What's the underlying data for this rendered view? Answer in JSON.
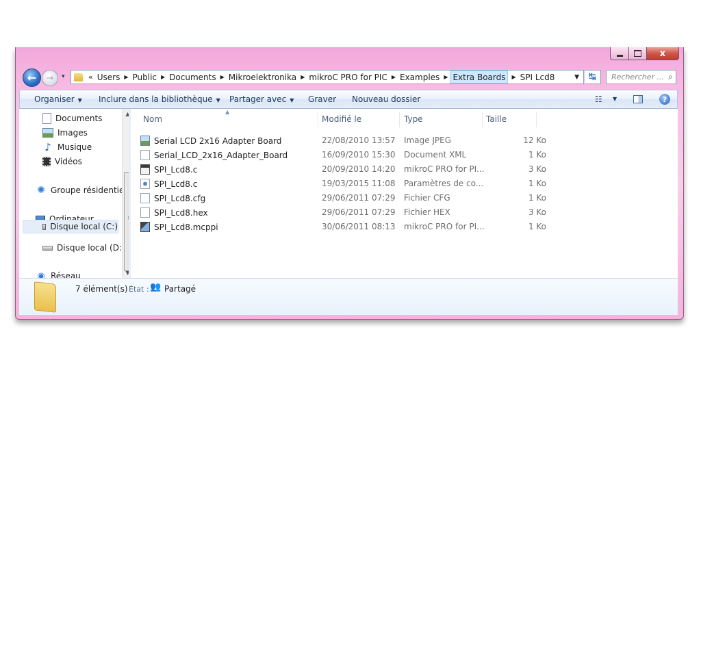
{
  "window": {
    "close_glyph": "x"
  },
  "navigation": {
    "back_glyph": "←",
    "forward_glyph": "→",
    "history_glyph": "▾"
  },
  "address": {
    "overflow": "«",
    "crumbs": [
      "Users",
      "Public",
      "Documents",
      "Mikroelektronika",
      "mikroC PRO for PIC",
      "Examples",
      "Extra Boards",
      "SPI Lcd8"
    ],
    "refresh_glyph": "↹"
  },
  "search": {
    "placeholder": "Rechercher ..."
  },
  "toolbar": {
    "organize": "Organiser",
    "include_library": "Inclure dans la bibliothèque",
    "share_with": "Partager avec",
    "burn": "Graver",
    "new_folder": "Nouveau dossier",
    "help": "?"
  },
  "nav_pane": {
    "items": [
      "Documents",
      "Images",
      "Musique",
      "Vidéos",
      "Groupe résidentiel",
      "Ordinateur",
      "Disque local (C:)",
      "Disque local (D:)",
      "Réseau"
    ]
  },
  "columns": {
    "name": "Nom",
    "modified": "Modifié le",
    "type": "Type",
    "size": "Taille"
  },
  "files": [
    {
      "name": "Serial LCD 2x16 Adapter Board",
      "modified": "22/08/2010 13:57",
      "type": "Image JPEG",
      "size": "12 Ko"
    },
    {
      "name": "Serial_LCD_2x16_Adapter_Board",
      "modified": "16/09/2010 15:30",
      "type": "Document XML",
      "size": "1 Ko"
    },
    {
      "name": "SPI_Lcd8.c",
      "modified": "20/09/2010 14:20",
      "type": "mikroC PRO for PI...",
      "size": "3 Ko"
    },
    {
      "name": "SPI_Lcd8.c",
      "modified": "19/03/2015 11:08",
      "type": "Paramètres de co...",
      "size": "1 Ko"
    },
    {
      "name": "SPI_Lcd8.cfg",
      "modified": "29/06/2011 07:29",
      "type": "Fichier CFG",
      "size": "1 Ko"
    },
    {
      "name": "SPI_Lcd8.hex",
      "modified": "29/06/2011 07:29",
      "type": "Fichier HEX",
      "size": "3 Ko"
    },
    {
      "name": "SPI_Lcd8.mcppi",
      "modified": "30/06/2011 08:13",
      "type": "mikroC PRO for PI...",
      "size": "1 Ko"
    }
  ],
  "details": {
    "count": "7 élément(s)",
    "state_label": "État :",
    "state_value": "Partagé"
  },
  "colors": {
    "window_frame": "#f3a7dc",
    "toolbar_text": "#1e395b",
    "selection": "#cce8ff"
  }
}
